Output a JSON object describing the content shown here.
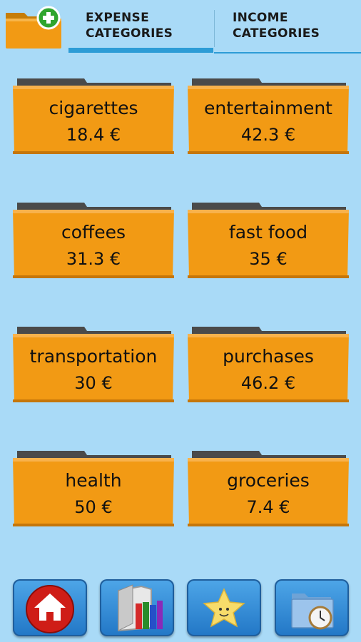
{
  "tabs": {
    "expense": [
      "EXPENSE",
      "CATEGORIES"
    ],
    "income": [
      "INCOME",
      "CATEGORIES"
    ],
    "active": "expense"
  },
  "categories": [
    {
      "name": "cigarettes",
      "amount": "18.4 €"
    },
    {
      "name": "entertainment",
      "amount": "42.3 €"
    },
    {
      "name": "coffees",
      "amount": "31.3 €"
    },
    {
      "name": "fast food",
      "amount": "35 €"
    },
    {
      "name": "transportation",
      "amount": "30 €"
    },
    {
      "name": "purchases",
      "amount": "46.2 €"
    },
    {
      "name": "health",
      "amount": "50 €"
    },
    {
      "name": "groceries",
      "amount": "7.4 €"
    }
  ],
  "icons": {
    "add": "add-folder-icon",
    "home": "home-icon",
    "reports": "folder-books-icon",
    "favorites": "star-icon",
    "history": "folder-clock-icon"
  },
  "colors": {
    "background": "#a9daf7",
    "folder": "#f29a14",
    "accent": "#2d9cd6"
  }
}
